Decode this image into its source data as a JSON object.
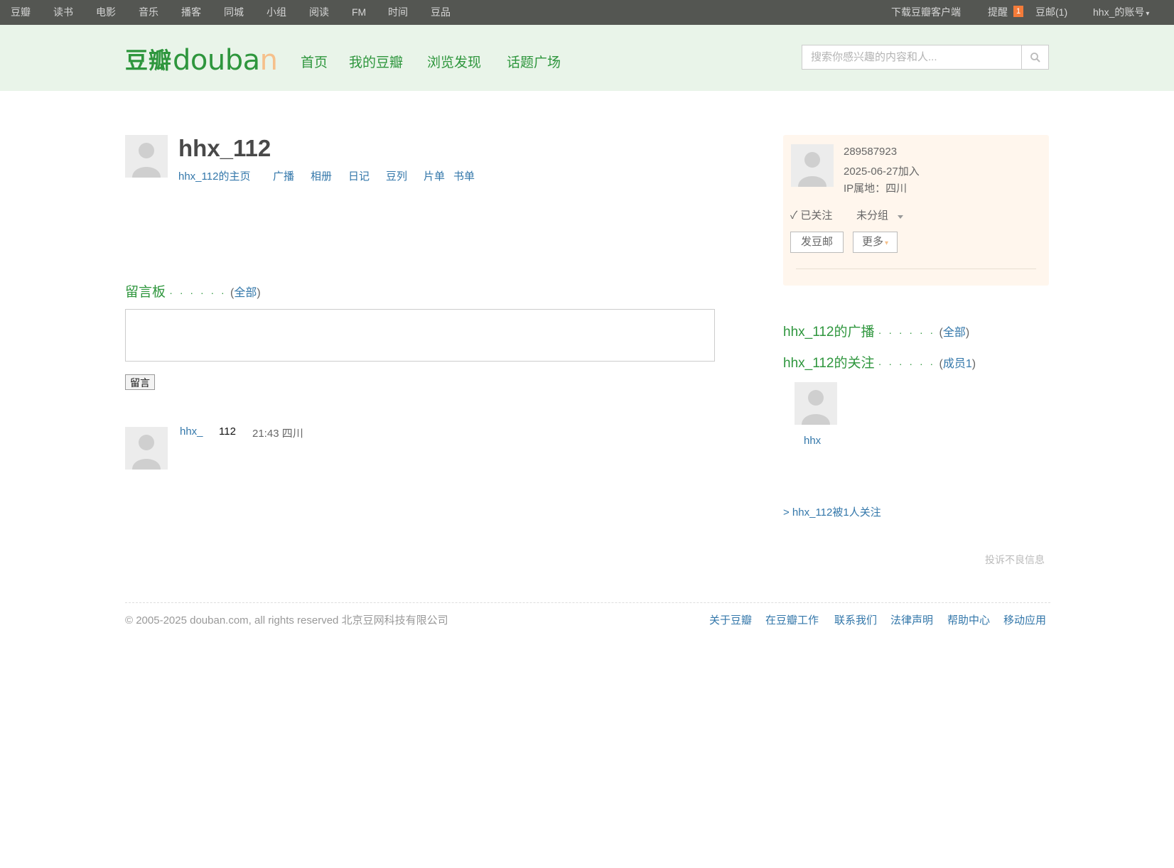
{
  "topbar": {
    "left_items": [
      "豆瓣",
      "读书",
      "电影",
      "音乐",
      "播客",
      "同城",
      "小组",
      "阅读",
      "FM",
      "时间",
      "豆品"
    ],
    "download": "下载豆瓣客户端",
    "remind": "提醒",
    "remind_count": "1",
    "mail": "豆邮",
    "mail_count": "(1)",
    "account": "hhx_的账号"
  },
  "header": {
    "logo_cn": "豆瓣",
    "logo_en_a": "douba",
    "logo_en_b": "n",
    "nav": [
      "首页",
      "我的豆瓣",
      "浏览发现",
      "话题广场"
    ],
    "search_placeholder": "搜索你感兴趣的内容和人..."
  },
  "profile": {
    "name": "hhx_112",
    "tabs": [
      "hhx_112的主页",
      "广播",
      "相册",
      "日记",
      "豆列",
      "片单",
      "书单"
    ]
  },
  "board": {
    "title": "留言板",
    "dots": "· · · · · ·",
    "all_open": "(",
    "all_link": "全部",
    "all_close": ")",
    "submit": "留言",
    "comment": {
      "user": "hhx_",
      "text": "112",
      "meta": "21:43 四川"
    }
  },
  "info": {
    "id": "289587923",
    "joined": "2025-06-27加入",
    "ip": "IP属地：四川",
    "follow_state": "✓ 已关注",
    "group": "未分组",
    "mail_button": "发豆邮",
    "more_button": "更多"
  },
  "right": {
    "broadcast_title": "hhx_112的广播",
    "broadcast_link": "全部",
    "following_title": "hhx_112的关注",
    "following_link": "成员1",
    "dots": "· · · · · ·",
    "open": "(",
    "close": ")",
    "follow_user": "hhx",
    "followed_by": "> hhx_112被1人关注",
    "report": "投诉不良信息"
  },
  "footer": {
    "copyright": "© 2005-2025 douban.com, all rights reserved 北京豆网科技有限公司",
    "links": [
      "关于豆瓣",
      "在豆瓣工作",
      "联系我们",
      "法律声明",
      "帮助中心",
      "移动应用"
    ]
  },
  "colors": {
    "brand_green": "#2e963d",
    "link_blue": "#3377aa",
    "topbar_bg": "#545652",
    "header_bg": "#e9f4e9"
  }
}
